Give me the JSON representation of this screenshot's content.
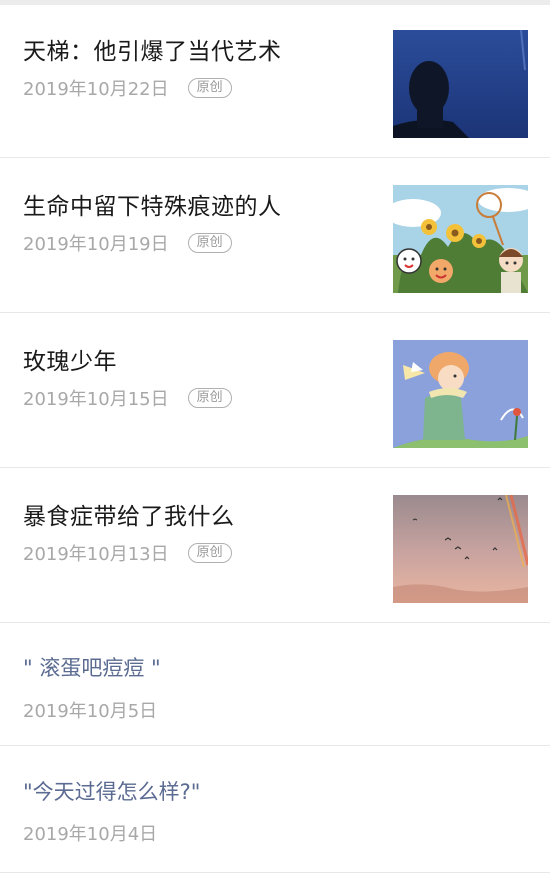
{
  "articles": [
    {
      "title": "天梯：他引爆了当代艺术",
      "date": "2019年10月22日",
      "badge": "原创",
      "thumbnail": "silhouette-night-photo"
    },
    {
      "title": "生命中留下特殊痕迹的人",
      "date": "2019年10月19日",
      "badge": "原创",
      "thumbnail": "cartoon-sunflowers-illustration"
    },
    {
      "title": "玫瑰少年",
      "date": "2019年10月15日",
      "badge": "原创",
      "thumbnail": "little-prince-illustration"
    },
    {
      "title": "暴食症带给了我什么",
      "date": "2019年10月13日",
      "badge": "原创",
      "thumbnail": "sunset-rainbow-birds-photo"
    }
  ],
  "quotes": [
    {
      "title": "\" 滚蛋吧痘痘 \"",
      "date": "2019年10月5日"
    },
    {
      "title": "\"今天过得怎么样?\"",
      "date": "2019年10月4日"
    }
  ],
  "colors": {
    "title": "#1a1a1a",
    "meta": "#a8a8a8",
    "quote_link": "#5b6b92",
    "divider": "#e8e8e8"
  }
}
